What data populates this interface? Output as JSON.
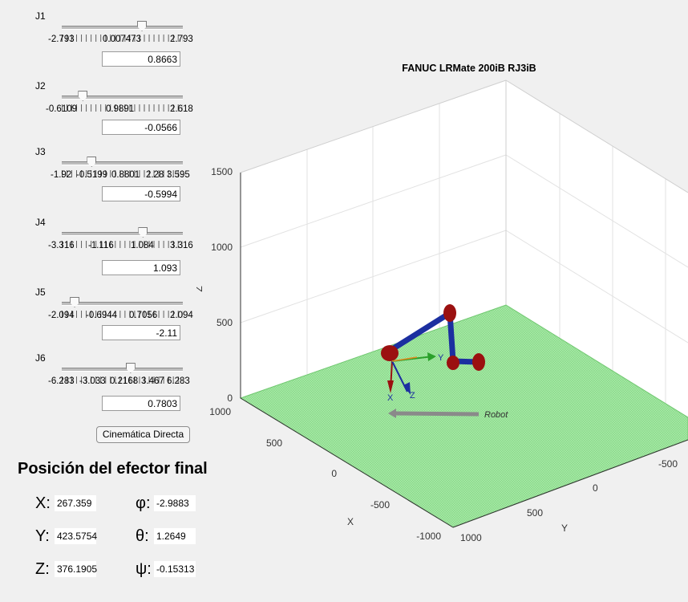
{
  "joints": [
    {
      "label": "J1",
      "ticks": [
        "-2.793",
        "0.007473",
        "2.793"
      ],
      "value": "0.8663",
      "fraction": 0.656
    },
    {
      "label": "J2",
      "ticks": [
        "-0.6109",
        "0.9891",
        "2.618"
      ],
      "value": "-0.0566",
      "fraction": 0.168
    },
    {
      "label": "J3",
      "ticks": [
        "-1.92",
        "-0.5199",
        "0.8801",
        "2.28",
        "3.595"
      ],
      "value": "-0.5994",
      "fraction": 0.241
    },
    {
      "label": "J4",
      "ticks": [
        "-3.316",
        "-1.116",
        "1.084",
        "3.316"
      ],
      "value": "1.093",
      "fraction": 0.665
    },
    {
      "label": "J5",
      "ticks": [
        "-2.094",
        "-0.6944",
        "0.7056",
        "2.094"
      ],
      "value": "-2.11",
      "fraction": 0.1
    },
    {
      "label": "J6",
      "ticks": [
        "-6.283",
        "-3.033",
        "0.2168",
        "3.467",
        "6.283"
      ],
      "value": "0.7803",
      "fraction": 0.562
    }
  ],
  "button_label": "Cinemática Directa",
  "position": {
    "title": "Posición del efector final",
    "x_label": "X:",
    "x": "267.359",
    "y_label": "Y:",
    "y": "423.5754",
    "z_label": "Z:",
    "z": "376.1905",
    "phi_label": "φ:",
    "phi": "-2.9883",
    "theta_label": "θ:",
    "theta": "1.2649",
    "psi_label": "ψ:",
    "psi": "-0.15313"
  },
  "plot": {
    "title": "FANUC LRMate 200iB RJ3iB",
    "z_axis_label": "Z",
    "x_axis_label": "X",
    "y_axis_label": "Y",
    "z_ticks": [
      "1500",
      "1000",
      "500",
      "0"
    ],
    "x_ticks": [
      "1000",
      "500",
      "0",
      "-500",
      "-1000"
    ],
    "y_ticks": [
      "1000",
      "500",
      "0",
      "-500"
    ],
    "robot_label": "Robot",
    "frame_labels": {
      "x": "X",
      "y": "Y",
      "z": "Z"
    },
    "colors": {
      "floor": "#99e699",
      "link": "#1c2fa0",
      "joint": "#9b1010",
      "grid": "#e0e0e0"
    }
  }
}
